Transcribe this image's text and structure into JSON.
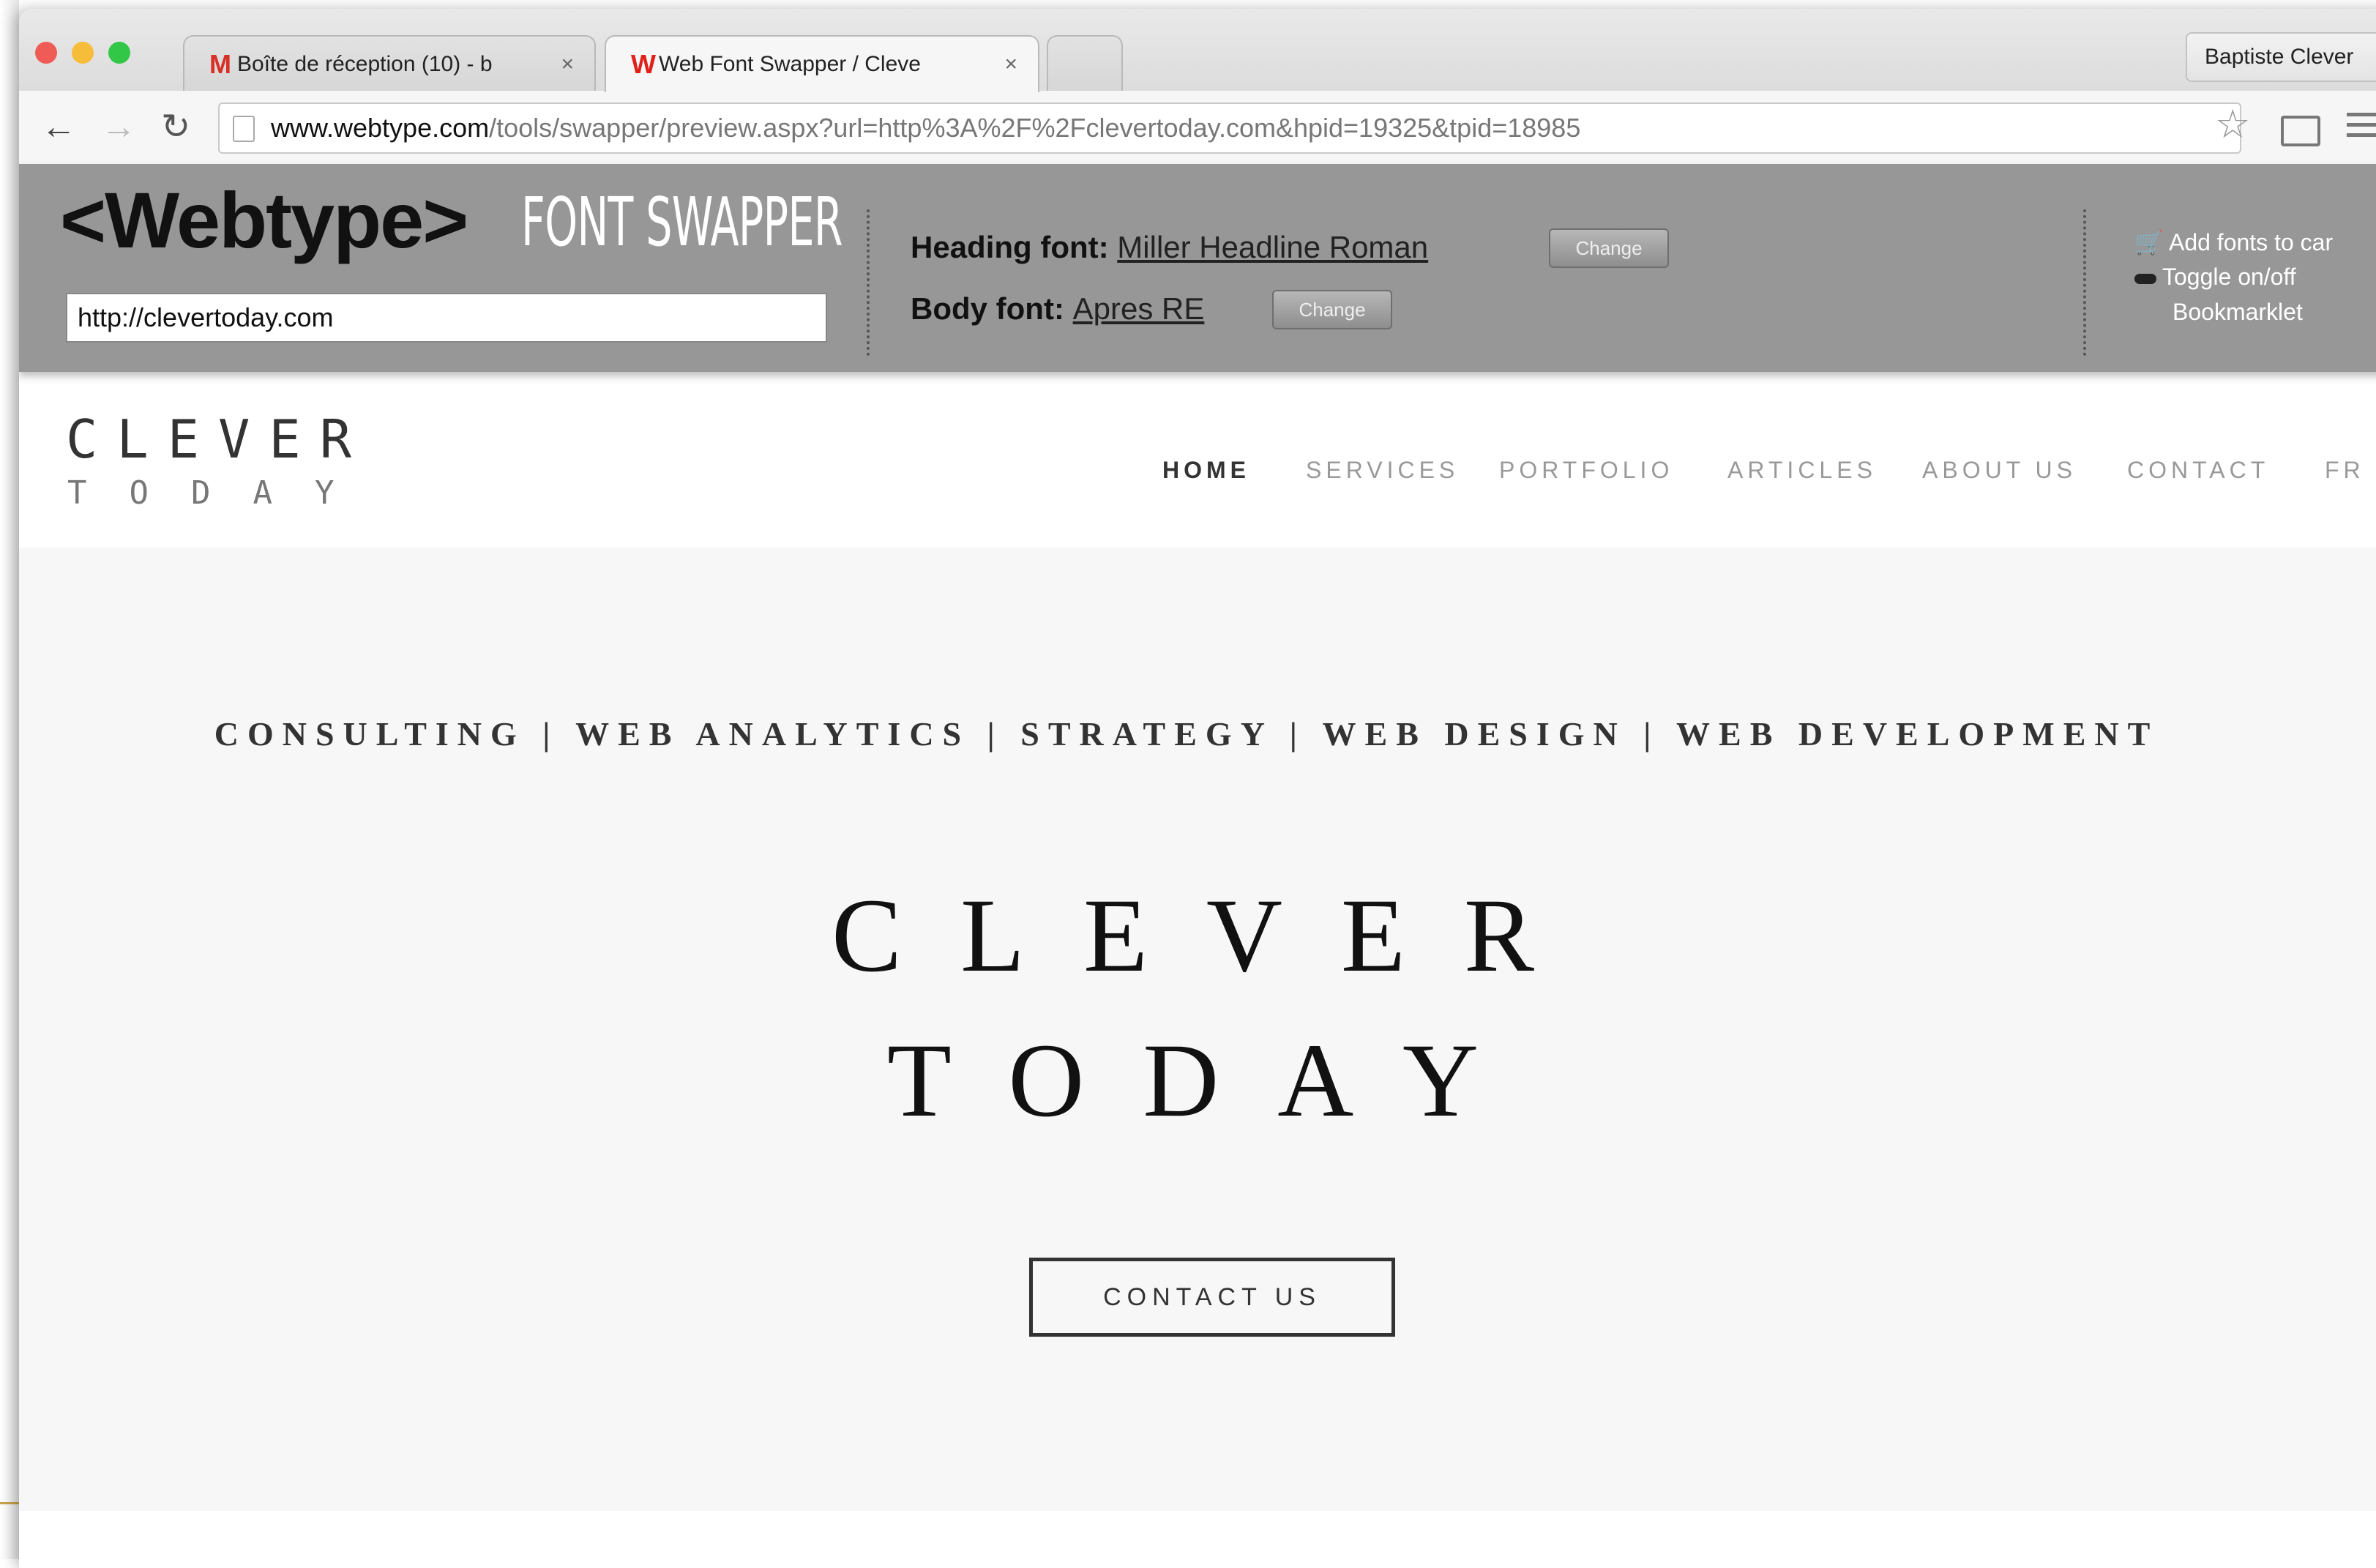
{
  "browser": {
    "tabs": [
      {
        "favicon": "M",
        "title": "Boîte de réception (10) - b",
        "close": "×"
      },
      {
        "favicon": "W",
        "title": "Web Font Swapper / Cleve",
        "close": "×"
      }
    ],
    "profile_name": "Baptiste Clever",
    "url_host": "www.webtype.com",
    "url_path": "/tools/swapper/preview.aspx?url=http%3A%2F%2Fclevertoday.com&hpid=19325&tpid=18985",
    "icons": {
      "back": "back-arrow-icon",
      "forward": "forward-arrow-icon",
      "reload": "reload-icon",
      "star": "star-icon",
      "cast": "cast-icon",
      "menu": "menu-icon"
    }
  },
  "webtype": {
    "logo": "<Webtype>",
    "product": "FONT SWAPPER",
    "url_value": "http://clevertoday.com",
    "heading_label": "Heading font:",
    "heading_font": "Miller Headline Roman",
    "body_label": "Body font:",
    "body_font": "Apres RE",
    "change_label": "Change",
    "add_fonts": "Add fonts to car",
    "toggle": "Toggle on/off",
    "bookmarklet": "Bookmarklet"
  },
  "site": {
    "logo_top": "CLEVER",
    "logo_bottom": "TODAY",
    "nav": [
      "HOME",
      "SERVICES",
      "PORTFOLIO",
      "ARTICLES",
      "ABOUT US",
      "CONTACT",
      "FR"
    ],
    "services_line": "CONSULTING | WEB ANALYTICS | STRATEGY | WEB DESIGN | WEB DEVELOPMENT",
    "hero_line1": "CLEVER",
    "hero_line2": "TODAY",
    "cta": "CONTACT US"
  },
  "colors": {
    "close": "#ee5c55",
    "minimize": "#f6bd3b",
    "maximize": "#33c748",
    "webtype_bar": "#979797",
    "hero_bg": "#f7f7f7"
  }
}
